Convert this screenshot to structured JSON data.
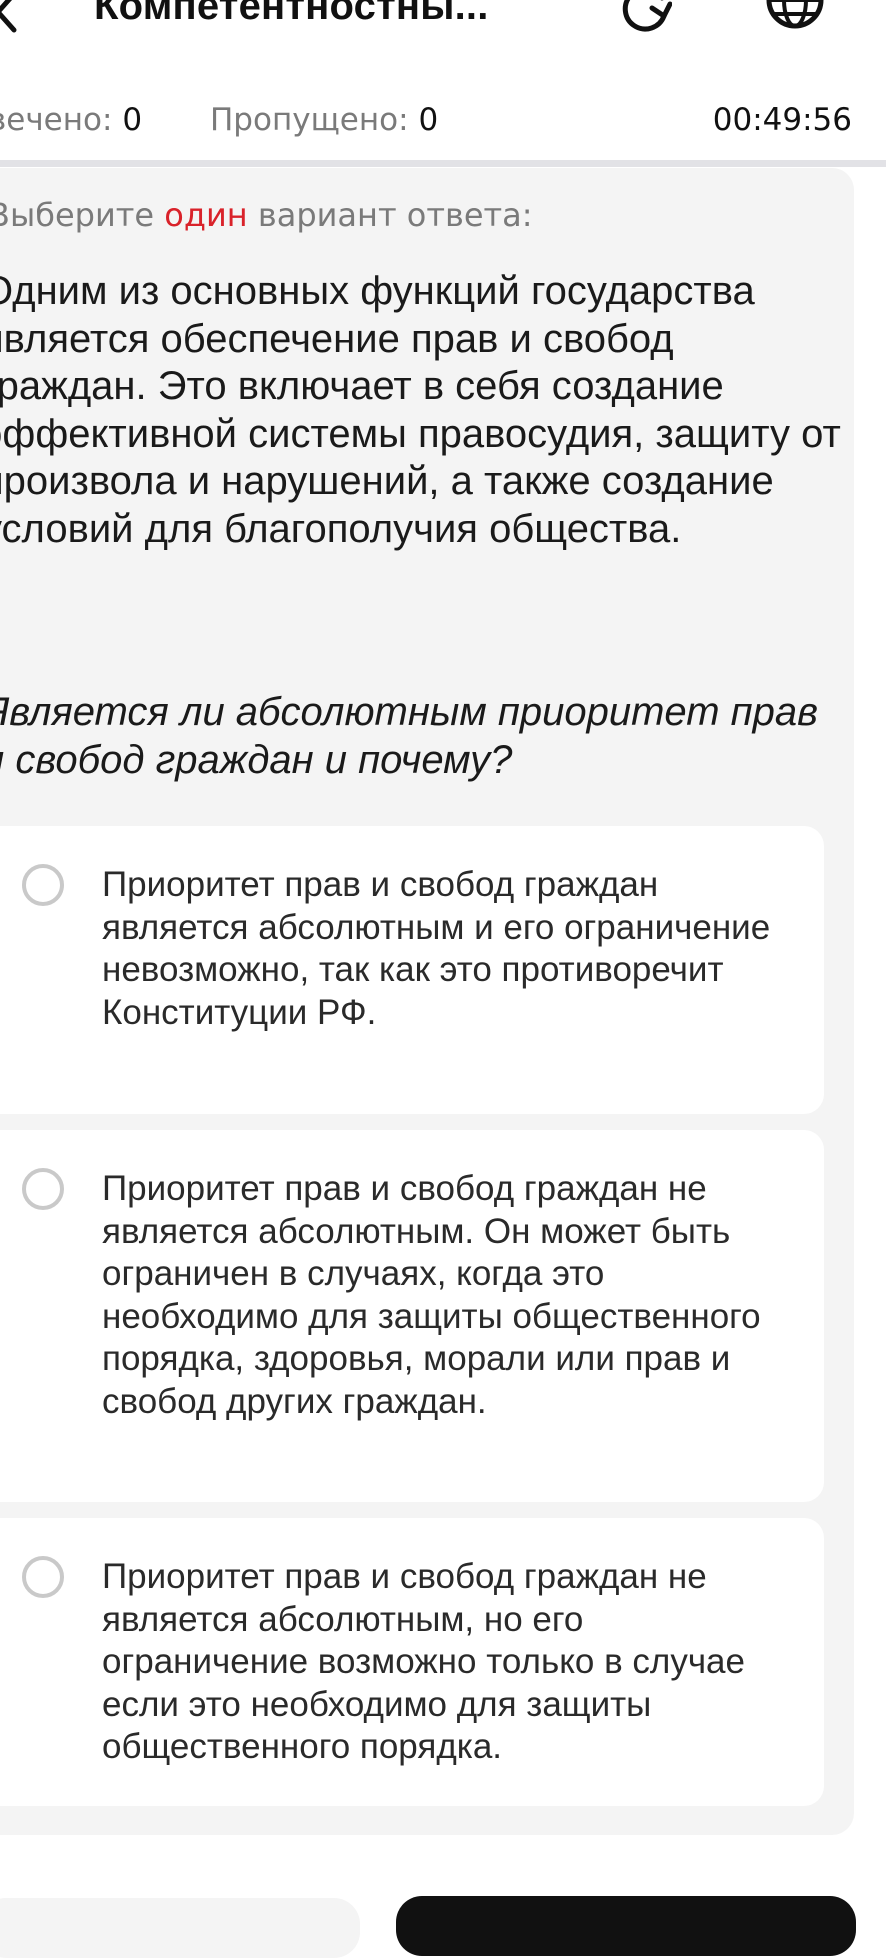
{
  "header": {
    "title": "Компетентностны..."
  },
  "stats": {
    "answered_label": "вечено:",
    "answered_value": "0",
    "skipped_label": "Пропущено:",
    "skipped_value": "0",
    "timer": "00:49:56"
  },
  "question": {
    "instruction_before": "Выберите ",
    "instruction_accent": "один",
    "instruction_after": " вариант ответа:",
    "text": "Одним из основных функций государства является обеспечение прав и свобод граждан. Это включает в себя создание эффективной системы правосудия, защиту от произвола и нарушений, а также создание условий для благополучия общества.",
    "ask": "Является ли абсолютным приоритет прав и свобод граждан и почему?"
  },
  "options": [
    {
      "text": "Приоритет прав и свобод граждан является абсолютным и его ограничение невозможно, так как это противоречит Конституции РФ."
    },
    {
      "text": "Приоритет прав и свобод граждан не является абсолютным. Он может быть ограничен в случаях, когда это необходимо для защиты общественного порядка, здоровья, морали или прав и свобод других граждан."
    },
    {
      "text": "Приоритет прав и свобод граждан не является абсолютным, но его ограничение возможно только в случае если это необходимо для защиты общественного порядка."
    }
  ],
  "colors": {
    "accent": "#d9222a",
    "panel_bg": "#f4f4f4",
    "card_bg": "#ffffff",
    "muted_text": "#7a7a7a"
  },
  "icons": {
    "back": "chevron-left-icon",
    "refresh": "refresh-icon",
    "language": "globe-icon",
    "option_marker": "radio-empty-icon"
  }
}
